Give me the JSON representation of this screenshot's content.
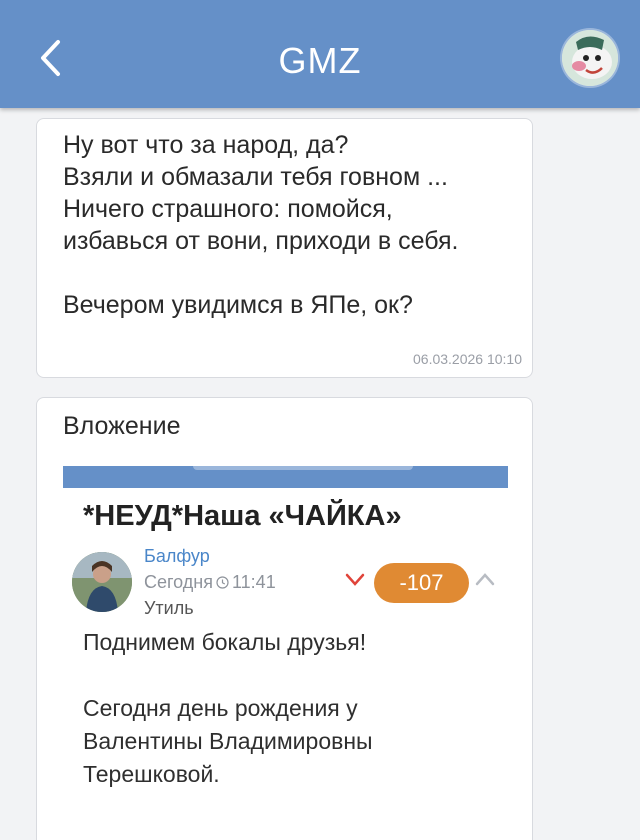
{
  "header": {
    "title": "GMZ",
    "back_icon": "chevron-left-icon",
    "avatar_icon": "cartoon-character-avatar"
  },
  "message": {
    "text": "Ну вот что за народ, да?\nВзяли и обмазали тебя говном ...\nНичего страшного: помойся,\nизбавься от вони, приходи в себя.\n\nВечером увидимся в ЯПе, ок?",
    "timestamp": "06.03.2026 10:10"
  },
  "attachment": {
    "label": "Вложение",
    "post": {
      "title": "*НЕУД*Наша «ЧАЙКА»",
      "author": "Балфур",
      "date": "Сегодня",
      "time": "11:41",
      "clock_icon": "clock-icon",
      "section": "Утиль",
      "rating": "-107",
      "body": "Поднимем бокалы друзья!\n\nСегодня день рождения у\nВалентины Владимировны\nТерешковой."
    }
  },
  "colors": {
    "header_bg": "#6590c8",
    "page_bg": "#f2f3f5",
    "rating_bg": "#e08a33",
    "vote_down": "#e0443a",
    "vote_up": "#b8bcc3",
    "author_link": "#4a86c9"
  }
}
